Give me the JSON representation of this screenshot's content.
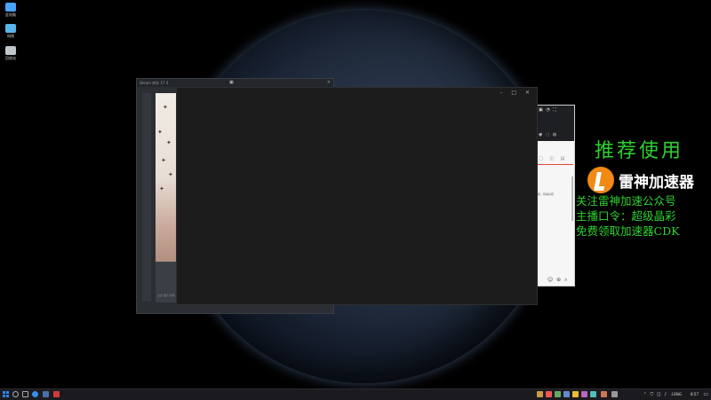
{
  "desktop": {
    "icons": [
      {
        "label": "此电脑",
        "icon": "computer-icon"
      },
      {
        "label": "网络",
        "icon": "network-icon"
      },
      {
        "label": "回收站",
        "icon": "recycle-bin-icon"
      }
    ]
  },
  "windows": {
    "back": {
      "title": "Steam 库存 17 4",
      "close_glyph": "×",
      "caption": "点击 图片 获取 更多信息"
    },
    "main": {
      "controls": "– □ ✕"
    },
    "right": {
      "snippet": "吧，乾嘛好吧"
    }
  },
  "promo": {
    "title": "推荐使用",
    "logo_text": "雷神加速器",
    "lines": [
      "关注雷神加速公众号",
      "主播口令：超级晶彩",
      "免费领取加速器CDK"
    ],
    "color": "#2fd12f",
    "logo_color": "#f08a14"
  },
  "taskbar": {
    "lang": "ENG",
    "clock": "8:57",
    "tray_icons": [
      "chevron-up-icon",
      "shield-icon",
      "speaker-icon",
      "network-icon",
      "battery-icon"
    ]
  }
}
